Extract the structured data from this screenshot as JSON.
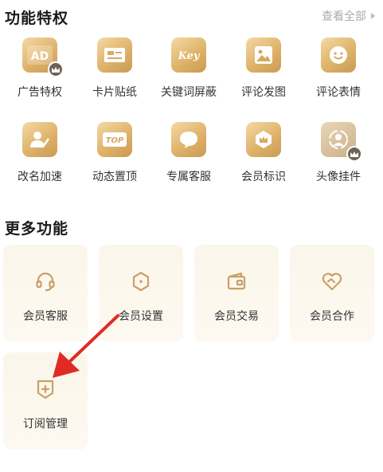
{
  "privileges": {
    "title": "功能特权",
    "view_all": "查看全部",
    "items": [
      {
        "label": "广告特权",
        "icon": "ad-icon",
        "glyph": "AD",
        "badge": true
      },
      {
        "label": "卡片贴纸",
        "icon": "card-sticker-icon"
      },
      {
        "label": "关键词屏蔽",
        "icon": "keyword-block-icon",
        "glyph": "Key"
      },
      {
        "label": "评论发图",
        "icon": "comment-image-icon"
      },
      {
        "label": "评论表情",
        "icon": "comment-emoji-icon"
      },
      {
        "label": "改名加速",
        "icon": "rename-speedup-icon"
      },
      {
        "label": "动态置顶",
        "icon": "pin-top-icon",
        "glyph": "TOP"
      },
      {
        "label": "专属客服",
        "icon": "exclusive-service-icon"
      },
      {
        "label": "会员标识",
        "icon": "member-badge-icon"
      },
      {
        "label": "头像挂件",
        "icon": "avatar-pendant-icon",
        "badge": true
      }
    ]
  },
  "more": {
    "title": "更多功能",
    "items": [
      {
        "label": "会员客服",
        "icon": "headset-icon"
      },
      {
        "label": "会员设置",
        "icon": "hexagon-settings-icon"
      },
      {
        "label": "会员交易",
        "icon": "wallet-icon"
      },
      {
        "label": "会员合作",
        "icon": "handshake-heart-icon"
      },
      {
        "label": "订阅管理",
        "icon": "subscribe-plus-icon"
      }
    ]
  },
  "colors": {
    "accent": "#c99a52",
    "icon_stroke": "#c9a06a",
    "arrow": "#e02b25"
  }
}
